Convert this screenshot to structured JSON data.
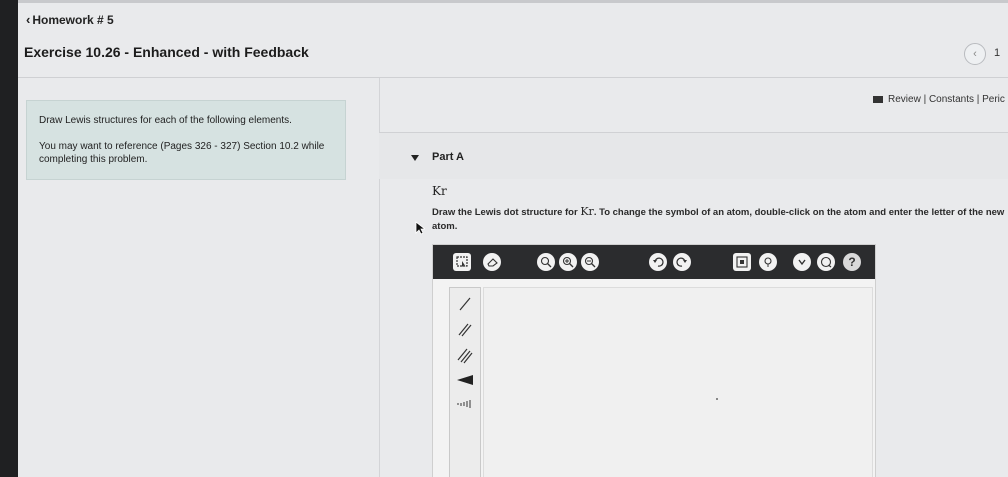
{
  "nav": {
    "back_label": "Homework # 5"
  },
  "header": {
    "title": "Exercise 10.26 - Enhanced - with Feedback",
    "pager_label": "1"
  },
  "intro": {
    "line1": "Draw Lewis structures for each of the following elements.",
    "line2": "You may want to reference (Pages 326 - 327) Section 10.2 while completing this problem."
  },
  "review_links": {
    "text": "Review | Constants | Peric"
  },
  "partA": {
    "label": "Part A",
    "element_symbol": "Kr",
    "instruction_pre": "Draw the Lewis dot structure for ",
    "instruction_symbol": "Kr",
    "instruction_post": ". To change the symbol of an atom, double-click on the atom and enter the letter of the new atom."
  },
  "toolbar": {
    "icons": [
      "select-icon",
      "eraser-icon",
      "zoom-fit-icon",
      "zoom-in-icon",
      "zoom-out-icon",
      "undo-icon",
      "redo-icon",
      "template-icon",
      "lightbulb-icon",
      "chevron-down-icon",
      "info-icon",
      "help-icon"
    ]
  },
  "tools": {
    "icons": [
      "single-bond-icon",
      "double-bond-icon",
      "triple-bond-icon",
      "wedge-bond-icon",
      "hash-bond-icon"
    ]
  },
  "colors": {
    "toolbar_bg": "#2b2c2e",
    "intro_bg": "#d6e2e1"
  }
}
